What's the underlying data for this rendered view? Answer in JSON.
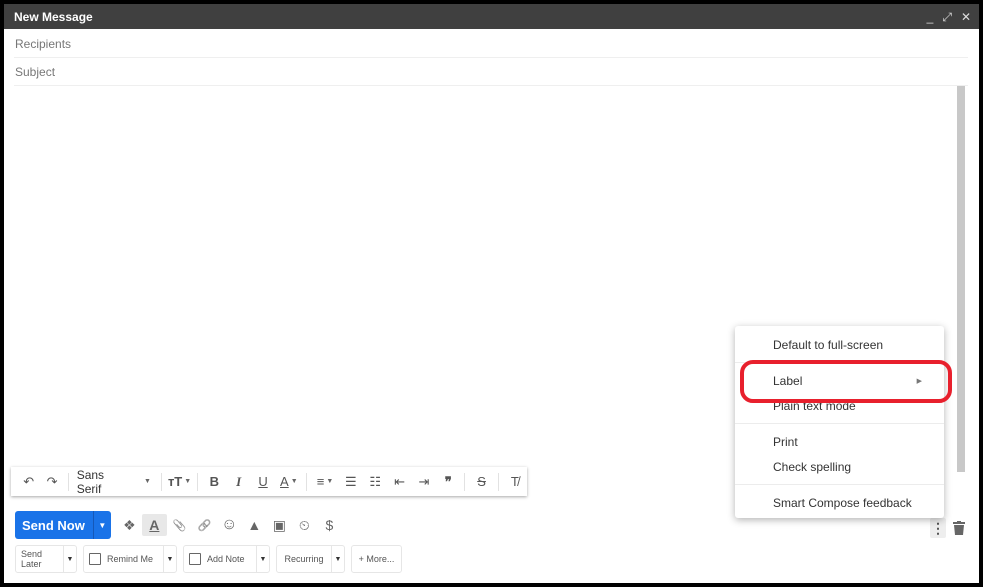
{
  "window": {
    "title": "New Message",
    "controls": {
      "minimize": "_",
      "expand": "⤢",
      "close": "✕"
    }
  },
  "fields": {
    "recipients_placeholder": "Recipients",
    "subject_placeholder": "Subject"
  },
  "formatting": {
    "undo": "↶",
    "redo": "↷",
    "font": "Sans Serif",
    "size_icon": "тT",
    "bold": "B",
    "italic": "I",
    "underline": "U",
    "text_color": "A",
    "align": "≡",
    "numbered_list": "☰",
    "bulleted_list": "☷",
    "indent_less": "⇤",
    "indent_more": "⇥",
    "quote": "❞",
    "strikethrough": "S",
    "remove_formatting": "T̸"
  },
  "send": {
    "label": "Send Now",
    "caret": "▼",
    "color": "#1a73e8"
  },
  "attach_icons": [
    {
      "name": "dropbox-icon",
      "glyph": "❖"
    },
    {
      "name": "formatting-toggle-icon",
      "glyph": "A"
    },
    {
      "name": "attach-icon",
      "glyph": "📎"
    },
    {
      "name": "link-icon",
      "glyph": "🔗"
    },
    {
      "name": "emoji-icon",
      "glyph": "☺"
    },
    {
      "name": "drive-icon",
      "glyph": "▲"
    },
    {
      "name": "photo-icon",
      "glyph": "▣"
    },
    {
      "name": "confidential-icon",
      "glyph": "⏲"
    },
    {
      "name": "payment-icon",
      "glyph": "$"
    }
  ],
  "extensions": {
    "send_later": "Send Later",
    "remind_me": "Remind Me",
    "add_note": "Add Note",
    "recurring": "Recurring",
    "more": "+ More..."
  },
  "menu": {
    "items": [
      {
        "label": "Default to full-screen"
      },
      {
        "label": "Label",
        "submenu": true
      },
      {
        "label": "Plain text mode"
      },
      {
        "label": "Print"
      },
      {
        "label": "Check spelling"
      },
      {
        "label": "Smart Compose feedback"
      }
    ],
    "submenu_arrow": "▶",
    "highlight_color": "#e8202d"
  },
  "more_options": "⋮"
}
